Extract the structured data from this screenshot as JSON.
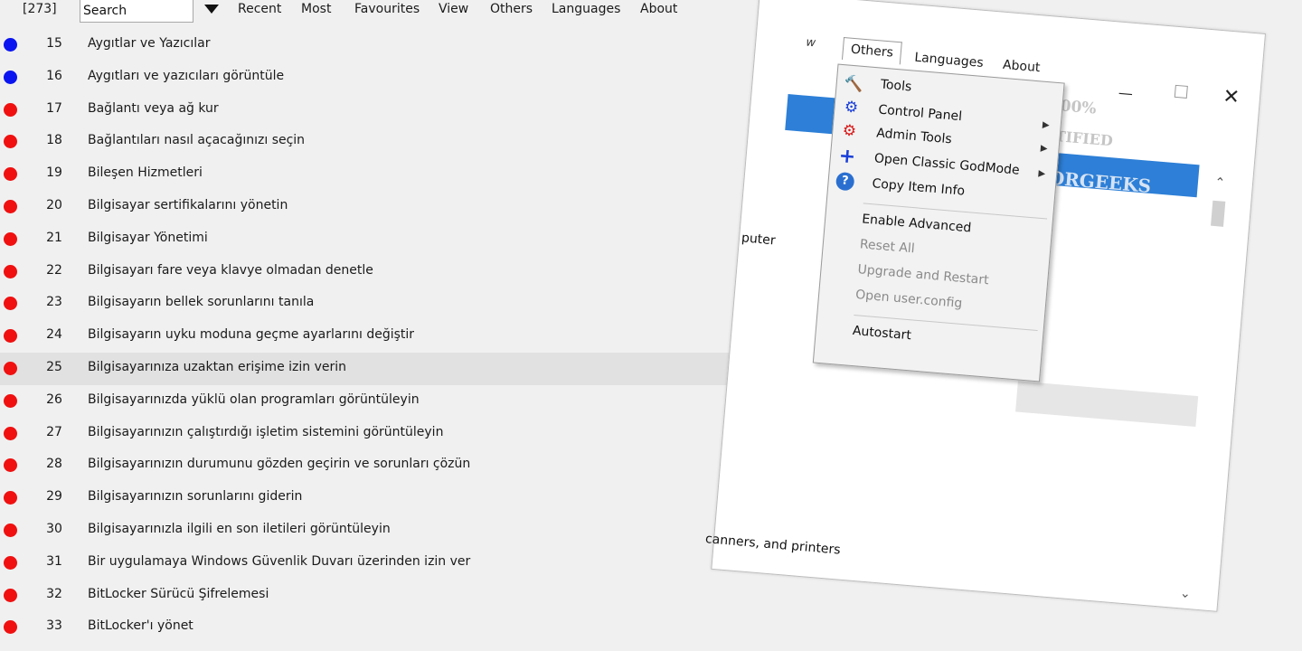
{
  "toolbar": {
    "count": "[273]",
    "search_value": "Search",
    "menu": [
      "Recent",
      "Most",
      "Favourites",
      "View",
      "Others",
      "Languages",
      "About"
    ]
  },
  "rows": [
    {
      "num": "15",
      "label": "Aygıtlar ve Yazıcılar",
      "color": "#0a14f0"
    },
    {
      "num": "16",
      "label": "Aygıtları ve yazıcıları görüntüle",
      "color": "#0a14f0"
    },
    {
      "num": "17",
      "label": "Bağlantı veya ağ kur",
      "color": "#f01010"
    },
    {
      "num": "18",
      "label": "Bağlantıları nasıl açacağınızı seçin",
      "color": "#f01010"
    },
    {
      "num": "19",
      "label": "Bileşen Hizmetleri",
      "color": "#f01010"
    },
    {
      "num": "20",
      "label": "Bilgisayar sertifikalarını yönetin",
      "color": "#f01010"
    },
    {
      "num": "21",
      "label": "Bilgisayar Yönetimi",
      "color": "#f01010"
    },
    {
      "num": "22",
      "label": "Bilgisayarı fare veya klavye olmadan denetle",
      "color": "#f01010"
    },
    {
      "num": "23",
      "label": "Bilgisayarın bellek sorunlarını tanıla",
      "color": "#f01010"
    },
    {
      "num": "24",
      "label": "Bilgisayarın uyku moduna geçme ayarlarını değiştir",
      "color": "#f01010"
    },
    {
      "num": "25",
      "label": "Bilgisayarınıza uzaktan erişime izin verin",
      "color": "#f01010"
    },
    {
      "num": "26",
      "label": "Bilgisayarınızda yüklü olan programları görüntüleyin",
      "color": "#f01010"
    },
    {
      "num": "27",
      "label": "Bilgisayarınızın çalıştırdığı işletim sistemini görüntüleyin",
      "color": "#f01010"
    },
    {
      "num": "28",
      "label": "Bilgisayarınızın durumunu gözden geçirin ve sorunları çözün",
      "color": "#f01010"
    },
    {
      "num": "29",
      "label": "Bilgisayarınızın sorunlarını giderin",
      "color": "#f01010"
    },
    {
      "num": "30",
      "label": "Bilgisayarınızla ilgili en son iletileri görüntüleyin",
      "color": "#f01010"
    },
    {
      "num": "31",
      "label": "Bir uygulamaya Windows Güvenlik Duvarı üzerinden izin ver",
      "color": "#f01010"
    },
    {
      "num": "32",
      "label": "BitLocker Sürücü Şifrelemesi",
      "color": "#f01010"
    },
    {
      "num": "33",
      "label": "BitLocker'ı yönet",
      "color": "#f01010"
    }
  ],
  "selected_row": "25",
  "window": {
    "fragment_left": "w",
    "fragment_puter": "puter",
    "fragment_scanners": "canners, and printers",
    "tabs": [
      "Others",
      "Languages",
      "About"
    ],
    "watermark": [
      "TESTED ★100% CLEAN",
      "CERTIFIED",
      "MAJORGEEKS"
    ],
    "popup": {
      "items": [
        {
          "label": "Tools",
          "icon": "tools-icon",
          "enabled": true,
          "submenu": false
        },
        {
          "label": "Control Panel",
          "icon": "blue-gear-icon",
          "enabled": true,
          "submenu": true
        },
        {
          "label": "Admin Tools",
          "icon": "red-gear-icon",
          "enabled": true,
          "submenu": true
        },
        {
          "label": "Open Classic GodMode",
          "icon": "plus-icon",
          "enabled": true,
          "submenu": true
        },
        {
          "label": "Copy Item Info",
          "icon": "help-icon",
          "enabled": true,
          "submenu": false
        },
        {
          "label": "Enable Advanced",
          "enabled": true
        },
        {
          "label": "Reset All",
          "enabled": false
        },
        {
          "label": "Upgrade and Restart",
          "enabled": false
        },
        {
          "label": "Open user.config",
          "enabled": false
        },
        {
          "label": "Autostart",
          "enabled": true
        }
      ]
    }
  }
}
